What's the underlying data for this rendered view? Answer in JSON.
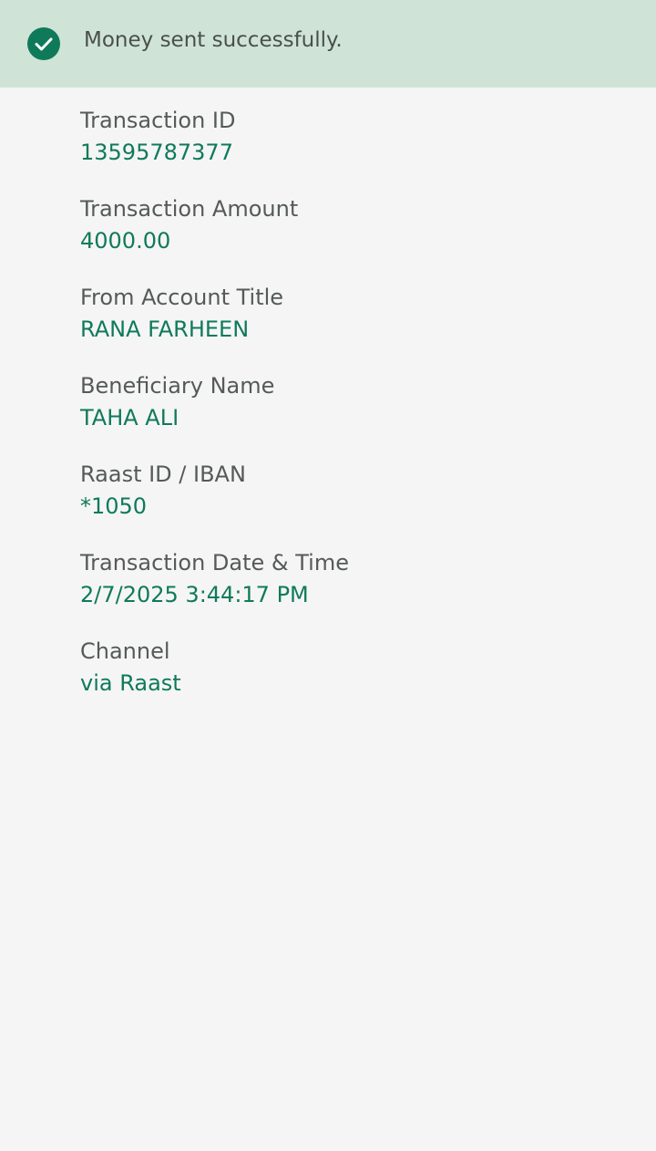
{
  "banner": {
    "message": "Money sent successfully.",
    "icon": "check-circle-icon",
    "accent_color": "#0f7a5a",
    "background_color": "#cfe4d6"
  },
  "fields": [
    {
      "label": "Transaction ID",
      "value": "13595787377"
    },
    {
      "label": "Transaction Amount",
      "value": "4000.00"
    },
    {
      "label": "From Account Title",
      "value": "RANA FARHEEN"
    },
    {
      "label": "Beneficiary Name",
      "value": "TAHA ALI"
    },
    {
      "label": "Raast ID / IBAN",
      "value": "*1050"
    },
    {
      "label": "Transaction Date & Time",
      "value": "2/7/2025 3:44:17 PM"
    },
    {
      "label": "Channel",
      "value": "via Raast"
    }
  ]
}
